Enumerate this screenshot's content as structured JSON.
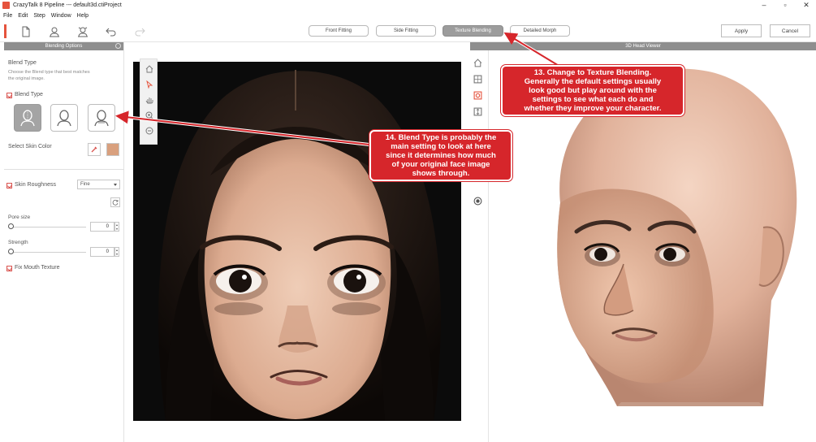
{
  "window": {
    "title": "CrazyTalk 8 Pipeline --- default3d.ctiProject",
    "controls": {
      "minimize": "–",
      "restore": "▫",
      "close": "✕"
    }
  },
  "menu": [
    "File",
    "Edit",
    "Step",
    "Window",
    "Help"
  ],
  "toolbar": {
    "icons": [
      "new-file-icon",
      "user-profile-icon",
      "user-settings-icon",
      "undo-icon",
      "redo-icon"
    ],
    "modes": [
      "Front Fitting",
      "Side Fitting",
      "Texture Blending",
      "Detailed Morph"
    ],
    "active_mode": "Texture Blending",
    "apply_label": "Apply",
    "cancel_label": "Cancel"
  },
  "left_panel": {
    "header": "Blending Options",
    "blend_title": "Blend Type",
    "blend_desc_1": "Choose the Blend type that best matches",
    "blend_desc_2": "the original image.",
    "blend_checkbox_label": "Blend Type",
    "skin_color_label": "Select Skin Color",
    "skin_color_swatch": "#d9a07e",
    "roughness_label": "Skin Roughness",
    "roughness_value": "Fine",
    "pore_label": "Pore size",
    "pore_value": "0",
    "strength_label": "Strength",
    "strength_value": "0",
    "fix_mouth_label": "Fix Mouth Texture"
  },
  "right_panel": {
    "header": "3D Head Viewer"
  },
  "callouts": {
    "c13": {
      "line1": "13. Change to Texture Blending.",
      "line2": "Generally the default settings usually",
      "line3": "look good but play around with the",
      "line4": "settings to see what each do and",
      "line5": "whether they improve your character."
    },
    "c14": {
      "line1": "14. Blend Type is probably the",
      "line2": "main setting to look at here",
      "line3": "since it determines how much",
      "line4": "of your original face image",
      "line5": "shows through."
    }
  },
  "colors": {
    "accent": "#e5533d",
    "callout": "#d6262b",
    "panel_header": "#8e8e8e"
  }
}
